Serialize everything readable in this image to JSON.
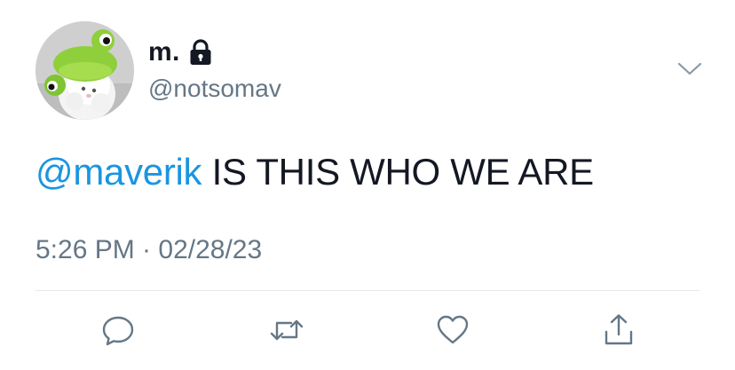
{
  "author": {
    "display_name": "m.",
    "handle": "@notsomav",
    "protected_icon": "lock-icon",
    "avatar": "frog-hat-plush-avatar"
  },
  "menu": {
    "icon": "chevron-down-icon"
  },
  "tweet": {
    "mention": "@maverik",
    "text": " IS THIS WHO WE ARE",
    "timestamp": "5:26 PM · 02/28/23"
  },
  "actions": {
    "reply_icon": "reply-icon",
    "retweet_icon": "retweet-icon",
    "like_icon": "heart-icon",
    "share_icon": "share-icon"
  },
  "colors": {
    "mention": "#1b95e0",
    "secondary_text": "#657786",
    "primary_text": "#141823",
    "icon": "#657786",
    "divider": "#e1e8ed"
  }
}
